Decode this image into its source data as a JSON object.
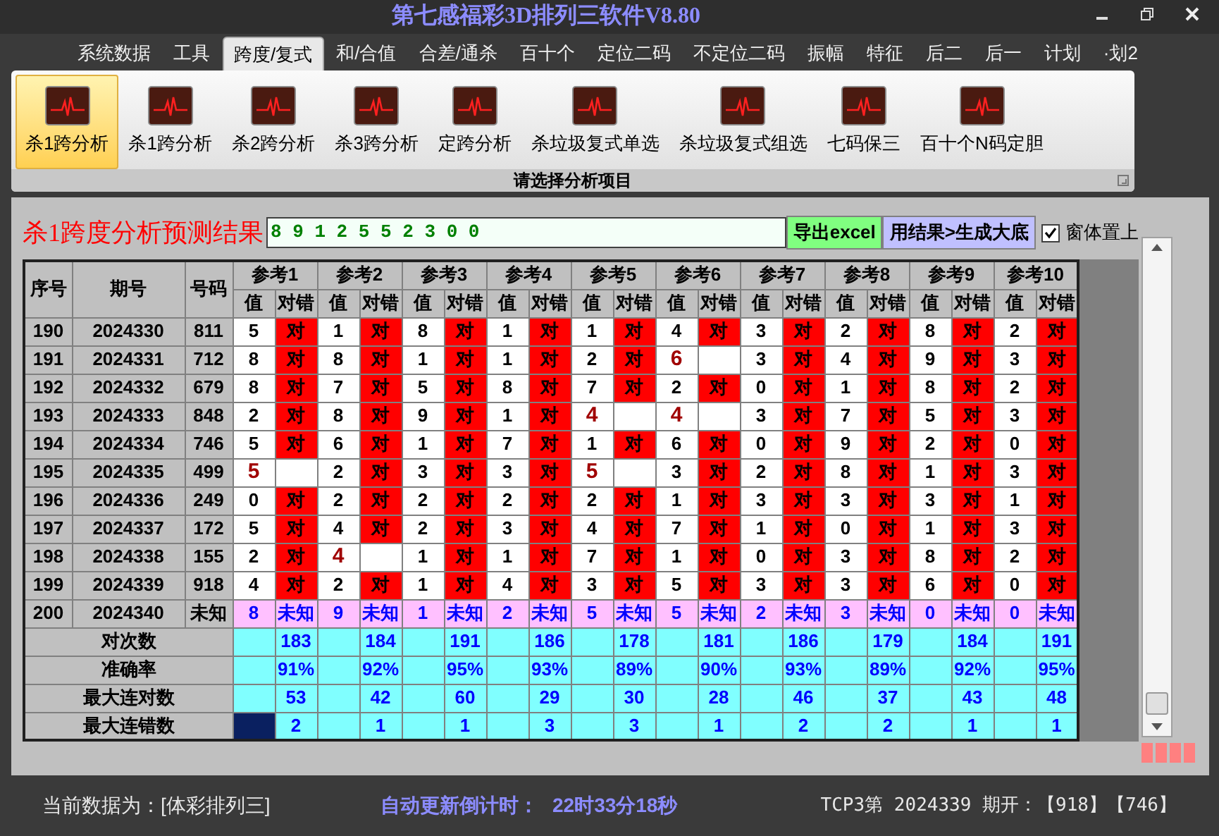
{
  "window": {
    "title": "第七感福彩3D排列三软件V8.80"
  },
  "menu": [
    {
      "label": "系统数据",
      "selected": false
    },
    {
      "label": "工具",
      "selected": false
    },
    {
      "label": "跨度/复式",
      "selected": true
    },
    {
      "label": "和/合值",
      "selected": false
    },
    {
      "label": "合差/通杀",
      "selected": false
    },
    {
      "label": "百十个",
      "selected": false
    },
    {
      "label": "定位二码",
      "selected": false
    },
    {
      "label": "不定位二码",
      "selected": false
    },
    {
      "label": "振幅",
      "selected": false
    },
    {
      "label": "特征",
      "selected": false
    },
    {
      "label": "后二",
      "selected": false
    },
    {
      "label": "后一",
      "selected": false
    },
    {
      "label": "计划",
      "selected": false
    },
    {
      "label": "·划2",
      "selected": false
    }
  ],
  "ribbon": {
    "items": [
      {
        "label": "杀1跨分析",
        "selected": true
      },
      {
        "label": "杀1跨分析",
        "selected": false
      },
      {
        "label": "杀2跨分析",
        "selected": false
      },
      {
        "label": "杀3跨分析",
        "selected": false
      },
      {
        "label": "定跨分析",
        "selected": false
      },
      {
        "label": "杀垃圾复式单选",
        "selected": false
      },
      {
        "label": "杀垃圾复式组选",
        "selected": false
      },
      {
        "label": "七码保三",
        "selected": false
      },
      {
        "label": "百十个N码定胆",
        "selected": false
      }
    ],
    "caption": "请选择分析项目"
  },
  "result": {
    "label": "杀1跨度分析预测结果",
    "value": "8 9 1 2 5 5 2 3 0 0"
  },
  "buttons": [
    {
      "label": "导出excel",
      "kind": "export"
    },
    {
      "label": "用结果>生成大底",
      "kind": "generate"
    }
  ],
  "pin_on_top": {
    "label": "窗体置上",
    "checked": true
  },
  "table": {
    "columns": [
      "序号",
      "期号",
      "号码"
    ],
    "groups": [
      {
        "label": "参考1",
        "subcolumns": [
          "值",
          "对错"
        ]
      },
      {
        "label": "参考2",
        "subcolumns": [
          "值",
          "对错"
        ]
      },
      {
        "label": "参考3",
        "subcolumns": [
          "值",
          "对错"
        ]
      },
      {
        "label": "参考4",
        "subcolumns": [
          "值",
          "对错"
        ]
      },
      {
        "label": "参考5",
        "subcolumns": [
          "值",
          "对错"
        ]
      },
      {
        "label": "参考6",
        "subcolumns": [
          "值",
          "对错"
        ]
      },
      {
        "label": "参考7",
        "subcolumns": [
          "值",
          "对错"
        ]
      },
      {
        "label": "参考8",
        "subcolumns": [
          "值",
          "对错"
        ]
      },
      {
        "label": "参考9",
        "subcolumns": [
          "值",
          "对错"
        ]
      },
      {
        "label": "参考10",
        "subcolumns": [
          "值",
          "对错"
        ]
      }
    ],
    "rows": [
      {
        "index": "190",
        "issue": "2024330",
        "number": "811",
        "refs": [
          {
            "value": "5",
            "hit": true,
            "text": "对"
          },
          {
            "value": "1",
            "hit": true,
            "text": "对"
          },
          {
            "value": "8",
            "hit": true,
            "text": "对"
          },
          {
            "value": "1",
            "hit": true,
            "text": "对"
          },
          {
            "value": "1",
            "hit": true,
            "text": "对"
          },
          {
            "value": "4",
            "hit": true,
            "text": "对"
          },
          {
            "value": "3",
            "hit": true,
            "text": "对"
          },
          {
            "value": "2",
            "hit": true,
            "text": "对"
          },
          {
            "value": "8",
            "hit": true,
            "text": "对"
          },
          {
            "value": "2",
            "hit": true,
            "text": "对"
          }
        ]
      },
      {
        "index": "191",
        "issue": "2024331",
        "number": "712",
        "refs": [
          {
            "value": "8",
            "hit": true,
            "text": "对"
          },
          {
            "value": "8",
            "hit": true,
            "text": "对"
          },
          {
            "value": "1",
            "hit": true,
            "text": "对"
          },
          {
            "value": "1",
            "hit": true,
            "text": "对"
          },
          {
            "value": "2",
            "hit": true,
            "text": "对"
          },
          {
            "value": "6",
            "hit": false
          },
          {
            "value": "3",
            "hit": true,
            "text": "对"
          },
          {
            "value": "4",
            "hit": true,
            "text": "对"
          },
          {
            "value": "9",
            "hit": true,
            "text": "对"
          },
          {
            "value": "3",
            "hit": true,
            "text": "对"
          }
        ]
      },
      {
        "index": "192",
        "issue": "2024332",
        "number": "679",
        "refs": [
          {
            "value": "8",
            "hit": true,
            "text": "对"
          },
          {
            "value": "7",
            "hit": true,
            "text": "对"
          },
          {
            "value": "5",
            "hit": true,
            "text": "对"
          },
          {
            "value": "8",
            "hit": true,
            "text": "对"
          },
          {
            "value": "7",
            "hit": true,
            "text": "对"
          },
          {
            "value": "2",
            "hit": true,
            "text": "对"
          },
          {
            "value": "0",
            "hit": true,
            "text": "对"
          },
          {
            "value": "1",
            "hit": true,
            "text": "对"
          },
          {
            "value": "8",
            "hit": true,
            "text": "对"
          },
          {
            "value": "2",
            "hit": true,
            "text": "对"
          }
        ]
      },
      {
        "index": "193",
        "issue": "2024333",
        "number": "848",
        "refs": [
          {
            "value": "2",
            "hit": true,
            "text": "对"
          },
          {
            "value": "8",
            "hit": true,
            "text": "对"
          },
          {
            "value": "9",
            "hit": true,
            "text": "对"
          },
          {
            "value": "1",
            "hit": true,
            "text": "对"
          },
          {
            "value": "4",
            "hit": false
          },
          {
            "value": "4",
            "hit": false
          },
          {
            "value": "3",
            "hit": true,
            "text": "对"
          },
          {
            "value": "7",
            "hit": true,
            "text": "对"
          },
          {
            "value": "5",
            "hit": true,
            "text": "对"
          },
          {
            "value": "3",
            "hit": true,
            "text": "对"
          }
        ]
      },
      {
        "index": "194",
        "issue": "2024334",
        "number": "746",
        "refs": [
          {
            "value": "5",
            "hit": true,
            "text": "对"
          },
          {
            "value": "6",
            "hit": true,
            "text": "对"
          },
          {
            "value": "1",
            "hit": true,
            "text": "对"
          },
          {
            "value": "7",
            "hit": true,
            "text": "对"
          },
          {
            "value": "1",
            "hit": true,
            "text": "对"
          },
          {
            "value": "6",
            "hit": true,
            "text": "对"
          },
          {
            "value": "0",
            "hit": true,
            "text": "对"
          },
          {
            "value": "9",
            "hit": true,
            "text": "对"
          },
          {
            "value": "2",
            "hit": true,
            "text": "对"
          },
          {
            "value": "0",
            "hit": true,
            "text": "对"
          }
        ]
      },
      {
        "index": "195",
        "issue": "2024335",
        "number": "499",
        "refs": [
          {
            "value": "5",
            "hit": false
          },
          {
            "value": "2",
            "hit": true,
            "text": "对"
          },
          {
            "value": "3",
            "hit": true,
            "text": "对"
          },
          {
            "value": "3",
            "hit": true,
            "text": "对"
          },
          {
            "value": "5",
            "hit": false
          },
          {
            "value": "3",
            "hit": true,
            "text": "对"
          },
          {
            "value": "2",
            "hit": true,
            "text": "对"
          },
          {
            "value": "8",
            "hit": true,
            "text": "对"
          },
          {
            "value": "1",
            "hit": true,
            "text": "对"
          },
          {
            "value": "3",
            "hit": true,
            "text": "对"
          }
        ]
      },
      {
        "index": "196",
        "issue": "2024336",
        "number": "249",
        "refs": [
          {
            "value": "0",
            "hit": true,
            "text": "对"
          },
          {
            "value": "2",
            "hit": true,
            "text": "对"
          },
          {
            "value": "2",
            "hit": true,
            "text": "对"
          },
          {
            "value": "2",
            "hit": true,
            "text": "对"
          },
          {
            "value": "2",
            "hit": true,
            "text": "对"
          },
          {
            "value": "1",
            "hit": true,
            "text": "对"
          },
          {
            "value": "3",
            "hit": true,
            "text": "对"
          },
          {
            "value": "3",
            "hit": true,
            "text": "对"
          },
          {
            "value": "3",
            "hit": true,
            "text": "对"
          },
          {
            "value": "1",
            "hit": true,
            "text": "对"
          }
        ]
      },
      {
        "index": "197",
        "issue": "2024337",
        "number": "172",
        "refs": [
          {
            "value": "5",
            "hit": true,
            "text": "对"
          },
          {
            "value": "4",
            "hit": true,
            "text": "对"
          },
          {
            "value": "2",
            "hit": true,
            "text": "对"
          },
          {
            "value": "3",
            "hit": true,
            "text": "对"
          },
          {
            "value": "4",
            "hit": true,
            "text": "对"
          },
          {
            "value": "7",
            "hit": true,
            "text": "对"
          },
          {
            "value": "1",
            "hit": true,
            "text": "对"
          },
          {
            "value": "0",
            "hit": true,
            "text": "对"
          },
          {
            "value": "1",
            "hit": true,
            "text": "对"
          },
          {
            "value": "3",
            "hit": true,
            "text": "对"
          }
        ]
      },
      {
        "index": "198",
        "issue": "2024338",
        "number": "155",
        "refs": [
          {
            "value": "2",
            "hit": true,
            "text": "对"
          },
          {
            "value": "4",
            "hit": false
          },
          {
            "value": "1",
            "hit": true,
            "text": "对"
          },
          {
            "value": "1",
            "hit": true,
            "text": "对"
          },
          {
            "value": "7",
            "hit": true,
            "text": "对"
          },
          {
            "value": "1",
            "hit": true,
            "text": "对"
          },
          {
            "value": "0",
            "hit": true,
            "text": "对"
          },
          {
            "value": "3",
            "hit": true,
            "text": "对"
          },
          {
            "value": "8",
            "hit": true,
            "text": "对"
          },
          {
            "value": "2",
            "hit": true,
            "text": "对"
          }
        ]
      },
      {
        "index": "199",
        "issue": "2024339",
        "number": "918",
        "refs": [
          {
            "value": "4",
            "hit": true,
            "text": "对"
          },
          {
            "value": "2",
            "hit": true,
            "text": "对"
          },
          {
            "value": "1",
            "hit": true,
            "text": "对"
          },
          {
            "value": "4",
            "hit": true,
            "text": "对"
          },
          {
            "value": "3",
            "hit": true,
            "text": "对"
          },
          {
            "value": "5",
            "hit": true,
            "text": "对"
          },
          {
            "value": "3",
            "hit": true,
            "text": "对"
          },
          {
            "value": "3",
            "hit": true,
            "text": "对"
          },
          {
            "value": "6",
            "hit": true,
            "text": "对"
          },
          {
            "value": "0",
            "hit": true,
            "text": "对"
          }
        ]
      }
    ],
    "forecast": {
      "index": "200",
      "issue": "2024340",
      "number": "未知",
      "refs": [
        {
          "value": "8",
          "text": "未知"
        },
        {
          "value": "9",
          "text": "未知"
        },
        {
          "value": "1",
          "text": "未知"
        },
        {
          "value": "2",
          "text": "未知"
        },
        {
          "value": "5",
          "text": "未知"
        },
        {
          "value": "5",
          "text": "未知"
        },
        {
          "value": "2",
          "text": "未知"
        },
        {
          "value": "3",
          "text": "未知"
        },
        {
          "value": "0",
          "text": "未知"
        },
        {
          "value": "0",
          "text": "未知"
        }
      ]
    },
    "stats": [
      {
        "label": "对次数",
        "focused": false,
        "values": [
          "183",
          "184",
          "191",
          "186",
          "178",
          "181",
          "186",
          "179",
          "184",
          "191"
        ]
      },
      {
        "label": "准确率",
        "focused": false,
        "values": [
          "91%",
          "92%",
          "95%",
          "93%",
          "89%",
          "90%",
          "93%",
          "89%",
          "92%",
          "95%"
        ]
      },
      {
        "label": "最大连对数",
        "focused": false,
        "values": [
          "53",
          "42",
          "60",
          "29",
          "30",
          "28",
          "46",
          "37",
          "43",
          "48"
        ]
      },
      {
        "label": "最大连错数",
        "focused": true,
        "values": [
          "2",
          "1",
          "1",
          "3",
          "3",
          "1",
          "2",
          "2",
          "1",
          "1"
        ]
      }
    ]
  },
  "status_bar": {
    "data_source": "当前数据为：[体彩排列三]",
    "countdown_label": "自动更新倒计时：",
    "countdown": "22时33分18秒",
    "latest": "TCP3第 2024339 期开：【918】【746】"
  }
}
